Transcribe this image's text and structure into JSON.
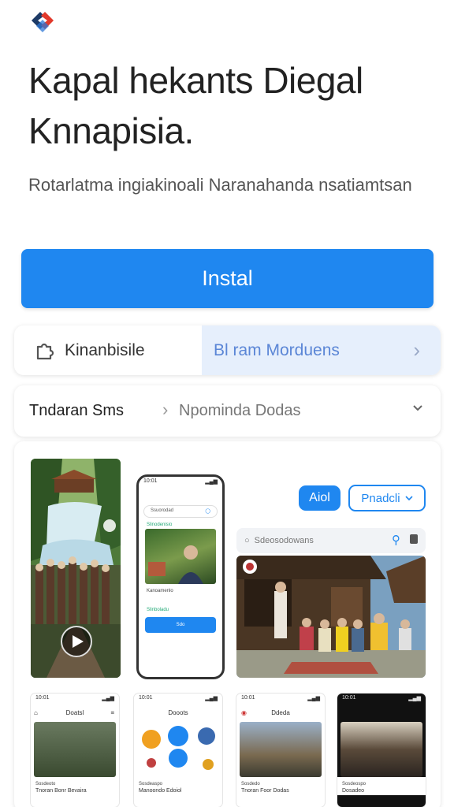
{
  "app": {
    "title": "Kapal hekants Diegal Knnapisia.",
    "subtitle": "Rotarlatma ingiakinoali Naranahanda nsatiamtsan",
    "install_label": "Instal"
  },
  "info_row": {
    "left_label": "Kinanbisile",
    "right_label": "Bl ram Morduens"
  },
  "detail_row": {
    "left_label": "Tndaran Sms",
    "mid_label": "Npominda Dodas"
  },
  "gallery": {
    "phone": {
      "time": "10:01",
      "search_text": "Ssuorodad",
      "tag1": "Slinodenisio",
      "caption1": "Kanoamenlo",
      "tag2": "Slinboladu",
      "button_label": "Sdo"
    },
    "chip_blue": "Aiol",
    "chip_outline": "Pnadcli",
    "search_text": "Sdeosodowans",
    "minis": [
      {
        "time": "10:01",
        "head": "Doatsl",
        "foot1": "Sosdeoto",
        "foot2": "Tnoran Bonr Bevaira"
      },
      {
        "time": "10:01",
        "head": "Dooots",
        "foot1": "Sosdeaspo",
        "foot2": "Manoondo Edoiol"
      },
      {
        "time": "10:01",
        "head": "Ddeda",
        "foot1": "Sosdedo",
        "foot2": "Tnoran Foor Dodas"
      },
      {
        "time": "10:01",
        "head": "",
        "foot1": "Sosdeospo",
        "foot2": "Dosadeo"
      }
    ]
  },
  "colors": {
    "accent": "#1f87f0",
    "highlight_bg": "#e6effc"
  },
  "icons": [
    "app-logo-icon",
    "puzzle-icon",
    "chevron-right-icon",
    "chevron-down-icon",
    "play-icon",
    "search-icon",
    "lock-icon"
  ]
}
